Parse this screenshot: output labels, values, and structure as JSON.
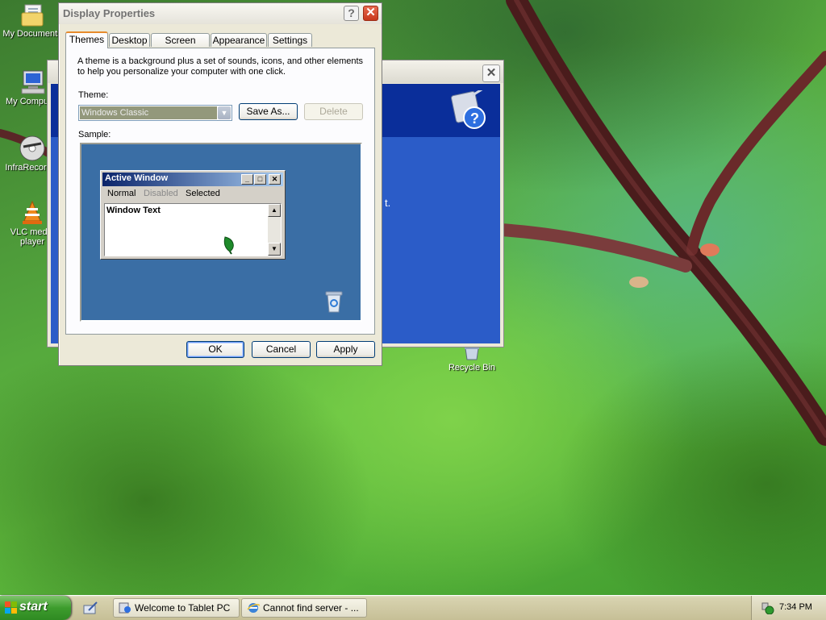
{
  "desktop": {
    "icons": [
      {
        "label": "My Documents"
      },
      {
        "label": "My Computer"
      },
      {
        "label": "InfraRecorder"
      },
      {
        "label": "VLC media player"
      },
      {
        "label": "Recycle Bin"
      }
    ]
  },
  "background_window": {
    "text_fragment": "t."
  },
  "dialog": {
    "title": "Display Properties",
    "help_button": "?",
    "close_button": "✕",
    "tabs": [
      {
        "label": "Themes",
        "active": true
      },
      {
        "label": "Desktop"
      },
      {
        "label": "Screen Saver"
      },
      {
        "label": "Appearance"
      },
      {
        "label": "Settings"
      }
    ],
    "description": "A theme is a background plus a set of sounds, icons, and other elements to help you personalize your computer with one click.",
    "theme_label": "Theme:",
    "theme_value": "Windows Classic",
    "save_as_label": "Save As...",
    "delete_label": "Delete",
    "sample_label": "Sample:",
    "sample": {
      "window_title": "Active Window",
      "menu": [
        "Normal",
        "Disabled",
        "Selected"
      ],
      "window_text": "Window Text"
    },
    "ok_label": "OK",
    "cancel_label": "Cancel",
    "apply_label": "Apply"
  },
  "taskbar": {
    "start_label": "start",
    "tasks": [
      {
        "label": "Welcome to Tablet PC"
      },
      {
        "label": "Cannot find server - ..."
      }
    ],
    "clock": "7:34 PM"
  },
  "colors": {
    "desktop_sample": "#3a6ea5",
    "xp_blue": "#2b5cc8",
    "start_green": "#3d9c2d"
  }
}
